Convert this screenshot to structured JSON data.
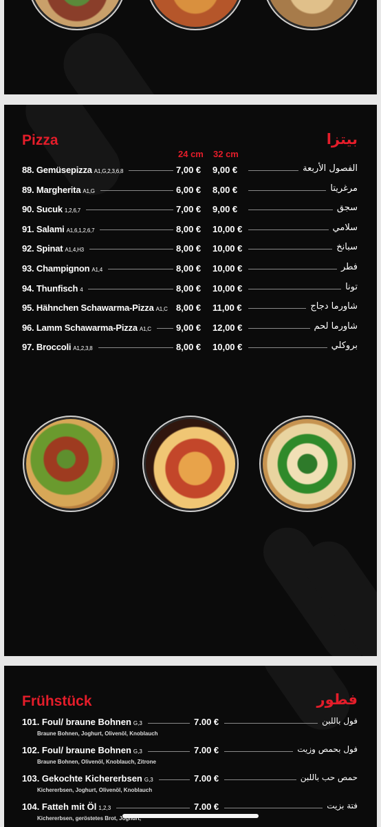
{
  "pizza": {
    "title_de": "Pizza",
    "title_ar": "بيتزا",
    "col_small": "24 cm",
    "col_large": "32 cm",
    "items": [
      {
        "name": "88. Gemüsepizza",
        "allergens": "A1,G,2,3,6,8",
        "p24": "7,00 €",
        "p32": "9,00 €",
        "ar": "الفصول الأربعة"
      },
      {
        "name": "89. Margherita",
        "allergens": "A1,G",
        "p24": "6,00 €",
        "p32": "8,00 €",
        "ar": "مرغريتا"
      },
      {
        "name": "90. Sucuk",
        "allergens": "1,2,6,7",
        "p24": "7,00 €",
        "p32": "9,00 €",
        "ar": "سجق"
      },
      {
        "name": "91. Salami",
        "allergens": "A1,6,1,2,6,7",
        "p24": "8,00 €",
        "p32": "10,00 €",
        "ar": "سلامي"
      },
      {
        "name": "92. Spinat",
        "allergens": "A1,4,H3",
        "p24": "8,00 €",
        "p32": "10,00 €",
        "ar": "سبانخ"
      },
      {
        "name": "93. Champignon",
        "allergens": "A1,4",
        "p24": "8,00 €",
        "p32": "10,00 €",
        "ar": "فطر"
      },
      {
        "name": "94. Thunfisch",
        "allergens": "4",
        "p24": "8,00 €",
        "p32": "10,00 €",
        "ar": "تونا"
      },
      {
        "name": "95. Hähnchen Schawarma-Pizza",
        "allergens": "A1,C",
        "p24": "8,00 €",
        "p32": "11,00 €",
        "ar": "شاورما دجاج"
      },
      {
        "name": "96. Lamm Schawarma-Pizza",
        "allergens": "A1,C",
        "p24": "9,00 €",
        "p32": "12,00 €",
        "ar": "شاورما لحم"
      },
      {
        "name": "97. Broccoli",
        "allergens": "A1,2,3,8",
        "p24": "8,00 €",
        "p32": "10,00 €",
        "ar": "بروكلي"
      }
    ]
  },
  "breakfast": {
    "title_de": "Frühstück",
    "title_ar": "فطور",
    "items": [
      {
        "name": "101. Foul/ braune Bohnen",
        "allergens": "G,3",
        "price": "7.00 €",
        "desc": "Braune Bohnen, Joghurt, Olivenöl, Knoblauch",
        "ar": "فول باللبن"
      },
      {
        "name": "102. Foul/ braune Bohnen",
        "allergens": "G,3",
        "price": "7.00 €",
        "desc": "Braune Bohnen, Olivenöl, Knoblauch, Zitrone",
        "ar": "فول بحمص وزيت"
      },
      {
        "name": "103. Gekochte Kichererbsen",
        "allergens": "G,3",
        "price": "7.00 €",
        "desc": "Kichererbsen, Joghurt, Olivenöl, Knoblauch",
        "ar": "حمص حب باللبن"
      },
      {
        "name": "104. Fatteh mit Öl",
        "allergens": "1,2,3",
        "price": "7.00 €",
        "desc": "Kichererbsen, geröstetes Brot, Joghurt,",
        "ar": "فتة بزيت"
      }
    ]
  },
  "colors": {
    "accent": "#e41d2a",
    "panel": "#0b0b0b",
    "background": "#e8e8e8"
  }
}
